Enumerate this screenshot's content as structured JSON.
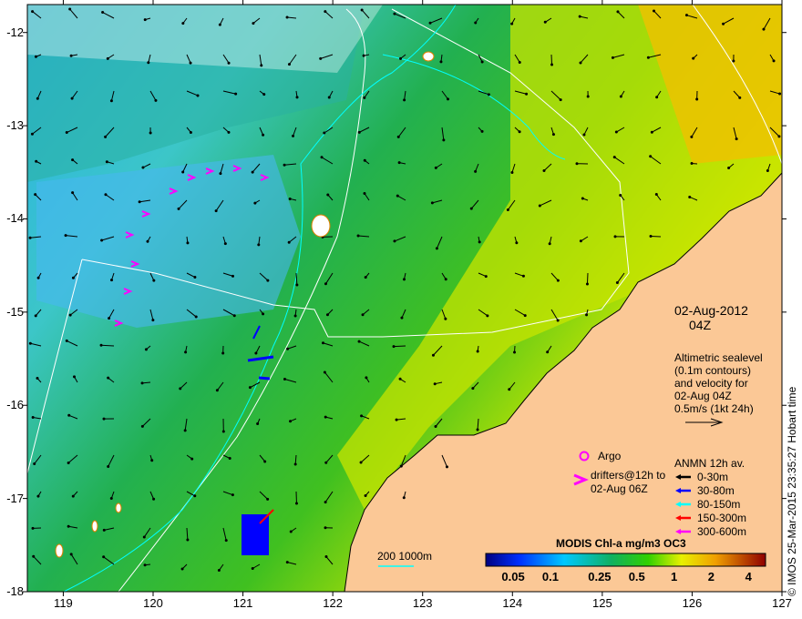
{
  "axes": {
    "lon_ticks": [
      "119",
      "120",
      "121",
      "122",
      "123",
      "124",
      "125",
      "126",
      "127"
    ],
    "lat_ticks": [
      "-12",
      "-13",
      "-14",
      "-15",
      "-16",
      "-17",
      "-18"
    ],
    "lon_range": [
      118.6,
      127.0
    ],
    "lat_range": [
      -18.0,
      -11.7
    ]
  },
  "date": {
    "line1": "02-Aug-2012",
    "line2": "04Z"
  },
  "altimetry": {
    "lines": [
      "Altimetric sealevel",
      "(0.1m contours)",
      "and velocity for",
      "02-Aug 04Z",
      "0.5m/s (1kt 24h)"
    ]
  },
  "argo_label": "Argo",
  "drifters": {
    "line1": "drifters@12h to",
    "line2": "02-Aug 06Z"
  },
  "anmn": {
    "title": "ANMN 12h av.",
    "items": [
      {
        "label": "0-30m",
        "color": "#000000"
      },
      {
        "label": "30-80m",
        "color": "#0000ff"
      },
      {
        "label": "80-150m",
        "color": "#00ffff"
      },
      {
        "label": "150-300m",
        "color": "#ff0000"
      },
      {
        "label": "300-600m",
        "color": "#ff00ff"
      }
    ]
  },
  "bathy_legend": "200  1000m",
  "colorbar": {
    "title": "MODIS Chl-a mg/m3 OC3",
    "labels": [
      "0.05",
      "0.1",
      "0.25",
      "0.5",
      "1",
      "2",
      "4"
    ]
  },
  "credit": "© IMOS 25-Mar-2015 23:35:27 Hobart time",
  "colors": {
    "land": "#fbc896",
    "bathy200": "#00ffff",
    "bathy1000": "#ffffff",
    "drifter": "#ff00ff"
  }
}
